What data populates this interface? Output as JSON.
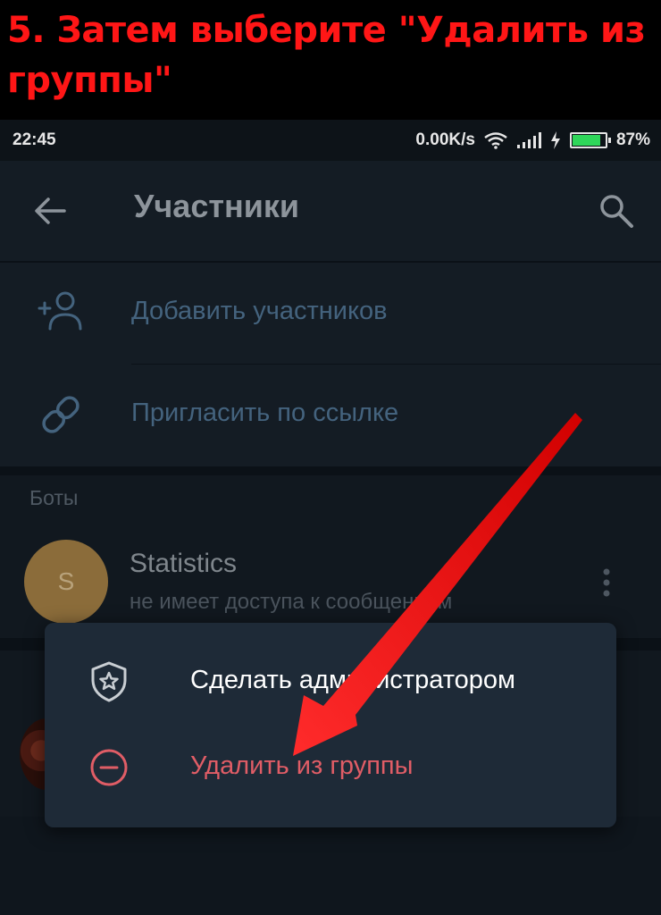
{
  "caption": {
    "text": "5. Затем выберите \"Удалить из группы\""
  },
  "status_bar": {
    "time": "22:45",
    "speed": "0.00K/s",
    "battery_percent": "87%",
    "battery_level": 0.87,
    "icons": [
      "wifi-icon",
      "signal-icon",
      "charging-icon",
      "battery-icon"
    ]
  },
  "app_bar": {
    "title": "Участники",
    "back_icon": "arrow-left-icon",
    "search_icon": "search-icon"
  },
  "actions": [
    {
      "icon": "add-user-icon",
      "label": "Добавить участников"
    },
    {
      "icon": "link-icon",
      "label": "Пригласить по ссылке"
    }
  ],
  "bots_section": {
    "header": "Боты",
    "member": {
      "avatar_letter": "S",
      "name": "Statistics",
      "status": "не имеет доступа к сообщениям"
    }
  },
  "context_menu": {
    "items": [
      {
        "icon": "shield-star-icon",
        "label": "Сделать администратором",
        "color": "#ffffff"
      },
      {
        "icon": "minus-circle-icon",
        "label": "Удалить из группы",
        "color": "#e05d66"
      }
    ]
  },
  "colors": {
    "caption": "#ff1616",
    "accent_arrow": "#e60000",
    "danger": "#e05d66",
    "background": "#0f161d"
  }
}
